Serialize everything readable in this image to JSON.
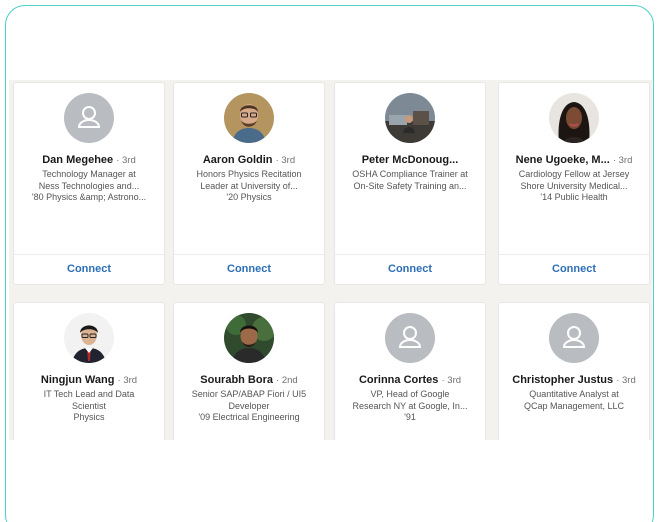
{
  "connect_label": "Connect",
  "people": [
    {
      "name": "Dan Megehee",
      "degree": "· 3rd",
      "headline": [
        "Technology Manager at",
        "Ness Technologies and...",
        "'80 Physics &amp; Astrono..."
      ],
      "avatar": "placeholder"
    },
    {
      "name": "Aaron Goldin",
      "degree": "· 3rd",
      "headline": [
        "Honors Physics Recitation",
        "Leader at University of...",
        "'20 Physics"
      ],
      "avatar": "photo"
    },
    {
      "name": "Peter McDonoug...",
      "degree": "",
      "headline": [
        "OSHA Compliance Trainer at",
        "On-Site Safety Training an..."
      ],
      "avatar": "photo"
    },
    {
      "name": "Nene Ugoeke, M...",
      "degree": "· 3rd",
      "headline": [
        "Cardiology Fellow at Jersey",
        "Shore University Medical...",
        "'14 Public Health"
      ],
      "avatar": "photo"
    },
    {
      "name": "Ningjun Wang",
      "degree": "· 3rd",
      "headline": [
        "IT Tech Lead and Data",
        "Scientist",
        "Physics"
      ],
      "avatar": "photo"
    },
    {
      "name": "Sourabh Bora",
      "degree": "· 2nd",
      "headline": [
        "Senior SAP/ABAP Fiori / UI5",
        "Developer",
        "'09 Electrical Engineering"
      ],
      "avatar": "photo"
    },
    {
      "name": "Corinna Cortes",
      "degree": "· 3rd",
      "headline": [
        "VP, Head of Google",
        "Research NY at Google, In...",
        "'91"
      ],
      "avatar": "placeholder"
    },
    {
      "name": "Christopher Justus",
      "degree": "· 3rd",
      "headline": [
        "Quantitative Analyst at",
        "QCap Management, LLC"
      ],
      "avatar": "placeholder"
    }
  ],
  "colors": {
    "accent": "#4fd0c8",
    "connect": "#2d6fb6",
    "placeholder": "#b9bcc0"
  }
}
